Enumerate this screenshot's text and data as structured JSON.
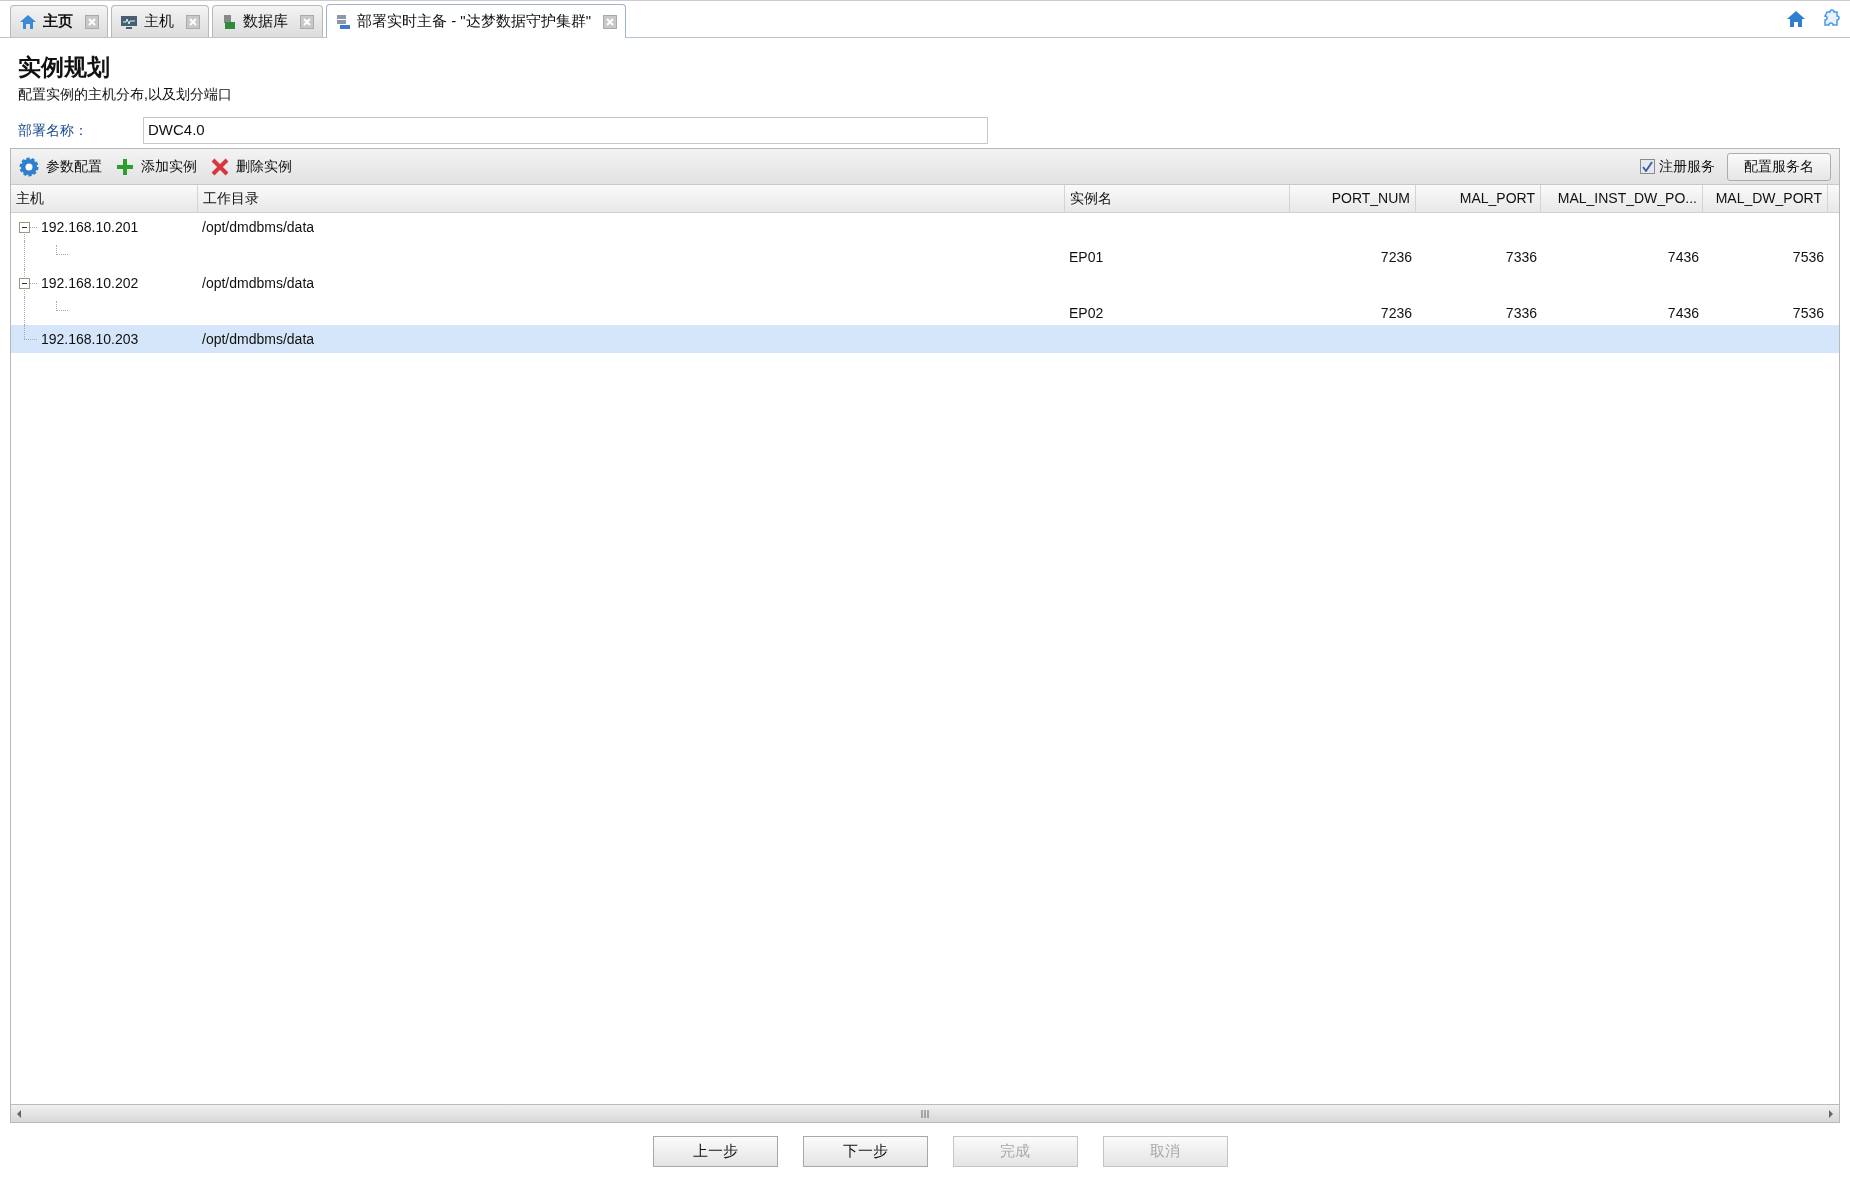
{
  "tabs": [
    {
      "label": "主页",
      "kind": "home",
      "selected": false
    },
    {
      "label": "主机",
      "kind": "monitor",
      "selected": false
    },
    {
      "label": "数据库",
      "kind": "database",
      "selected": false
    },
    {
      "label": "部署实时主备 - \"达梦数据守护集群\"",
      "kind": "server",
      "selected": true
    }
  ],
  "page": {
    "title": "实例规划",
    "subtitle": "配置实例的主机分布,以及划分端口"
  },
  "deploy_name": {
    "label": "部署名称：",
    "value": "DWC4.0"
  },
  "toolbar": {
    "actions": [
      {
        "label": "参数配置",
        "kind": "gear"
      },
      {
        "label": "添加实例",
        "kind": "plus"
      },
      {
        "label": "删除实例",
        "kind": "cross"
      }
    ],
    "register_service": {
      "label": "注册服务",
      "checked": true
    },
    "config_button": "配置服务名"
  },
  "table": {
    "columns": [
      "主机",
      "工作目录",
      "实例名",
      "PORT_NUM",
      "MAL_PORT",
      "MAL_INST_DW_PO...",
      "MAL_DW_PORT"
    ],
    "rows": [
      {
        "host": "192.168.10.201",
        "dir": "/opt/dmdbms/data",
        "expanded": true,
        "selected": false,
        "children": [
          {
            "name": "EP01",
            "port_num": "7236",
            "mal_port": "7336",
            "mal_inst_dw_port": "7436",
            "mal_dw_port": "7536"
          }
        ]
      },
      {
        "host": "192.168.10.202",
        "dir": "/opt/dmdbms/data",
        "expanded": true,
        "selected": false,
        "children": [
          {
            "name": "EP02",
            "port_num": "7236",
            "mal_port": "7336",
            "mal_inst_dw_port": "7436",
            "mal_dw_port": "7536"
          }
        ]
      },
      {
        "host": "192.168.10.203",
        "dir": "/opt/dmdbms/data",
        "selected": true
      }
    ]
  },
  "buttons": [
    {
      "label": "上一步",
      "disabled": false
    },
    {
      "label": "下一步",
      "disabled": false
    },
    {
      "label": "完成",
      "disabled": true
    },
    {
      "label": "取消",
      "disabled": true
    }
  ]
}
